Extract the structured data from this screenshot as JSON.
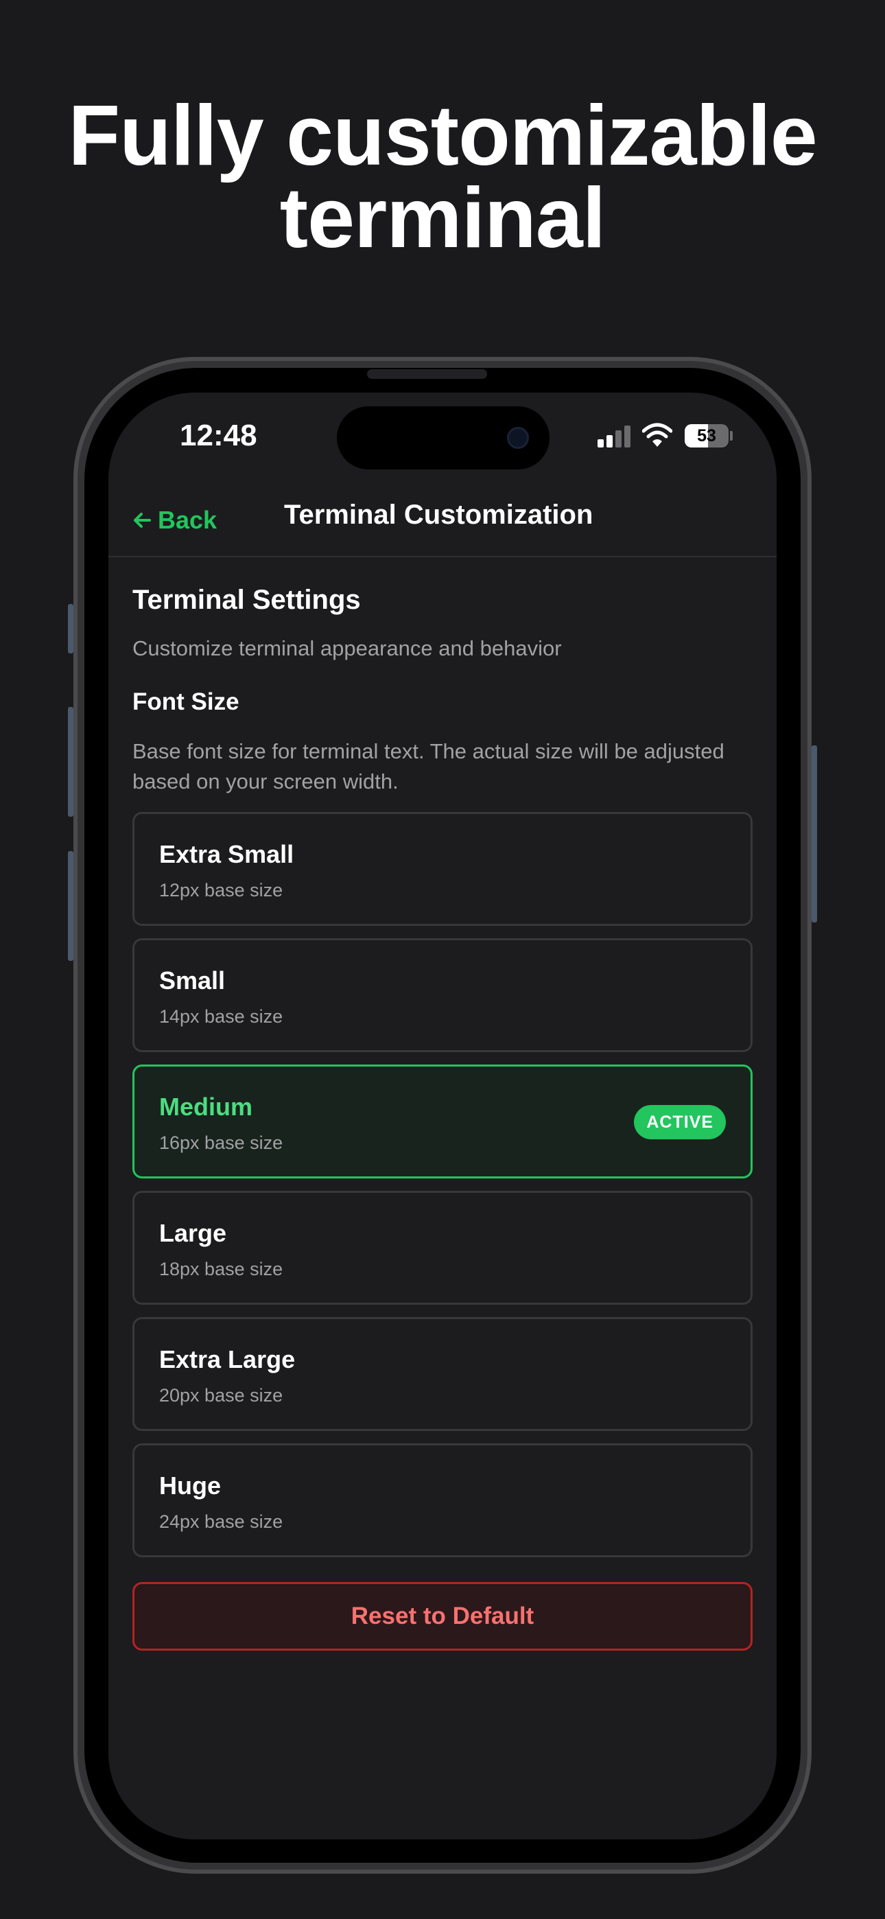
{
  "headline": {
    "line1": "Fully customizable",
    "line2": "terminal"
  },
  "status_bar": {
    "time": "12:48",
    "battery_level": "53",
    "battery_fraction": 0.53,
    "signal_bars_active": 2,
    "signal_bars_total": 4
  },
  "nav": {
    "back_label": "Back",
    "back_icon": "arrow-left-icon",
    "title": "Terminal Customization"
  },
  "settings": {
    "title": "Terminal Settings",
    "subtitle": "Customize terminal appearance and behavior",
    "font_size_label": "Font Size",
    "font_size_description": "Base font size for terminal text. The actual size will be adjusted based on your screen width."
  },
  "options": [
    {
      "name": "Extra Small",
      "desc": "12px base size"
    },
    {
      "name": "Small",
      "desc": "14px base size"
    },
    {
      "name": "Medium",
      "desc": "16px base size",
      "badge": "ACTIVE"
    },
    {
      "name": "Large",
      "desc": "18px base size"
    },
    {
      "name": "Extra Large",
      "desc": "20px base size"
    },
    {
      "name": "Huge",
      "desc": "24px base size"
    }
  ],
  "reset_label": "Reset to Default",
  "colors": {
    "accent": "#22c55e",
    "danger": "#f87171",
    "background": "#1c1c1e"
  }
}
